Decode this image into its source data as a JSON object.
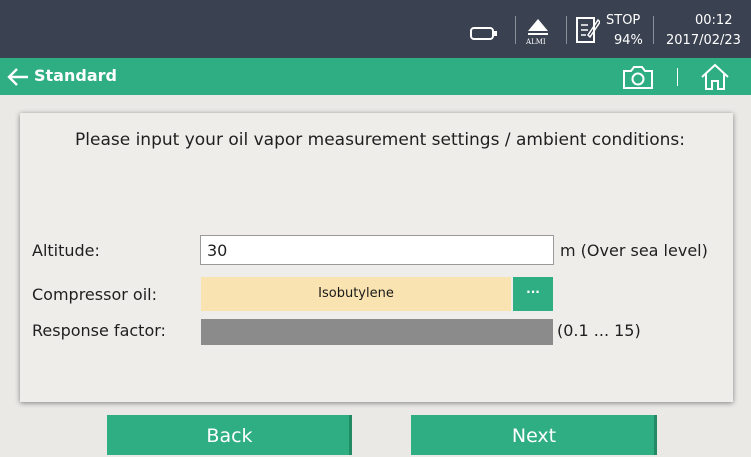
{
  "status_bar": {
    "alarm_label": "ALMI",
    "record_status": "STOP",
    "record_percent": "94%",
    "time": "00:12",
    "date": "2017/02/23"
  },
  "title_bar": {
    "title": "Standard",
    "icons": [
      "back-arrow-icon",
      "camera-icon",
      "home-icon"
    ]
  },
  "form": {
    "prompt": "Please input your oil vapor measurement settings / ambient conditions:",
    "altitude": {
      "label": "Altitude:",
      "value": "30",
      "unit": "m (Over sea level)"
    },
    "compressor_oil": {
      "label": "Compressor oil:",
      "value": "Isobutylene",
      "more_label": "···"
    },
    "response_factor": {
      "label": "Response factor:",
      "value": "",
      "range": "(0.1 ... 15)"
    }
  },
  "buttons": {
    "back": "Back",
    "next": "Next"
  },
  "colors": {
    "accent": "#2fae83",
    "status_bar": "#3a4150",
    "select_bg": "#f9e3b0",
    "disabled_field": "#8b8b8b"
  }
}
